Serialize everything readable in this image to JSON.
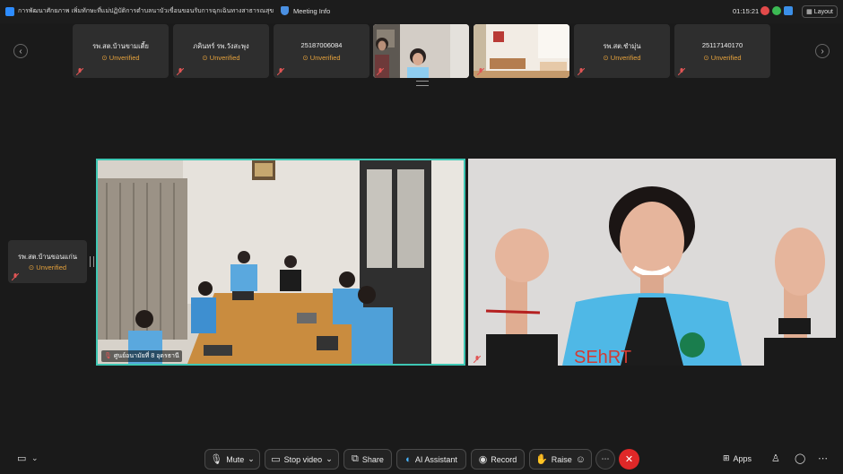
{
  "window": {
    "title": "การพัฒนาศักยภาพ เพิ่มทักษะที่แม่ปฏิบัติการตำบลนาบัวเขื่อนขอนรับการฉุกเฉินทางสาธารณสุข",
    "meeting_info": "Meeting Info",
    "time": "01:15:21",
    "layout_label": "Layout"
  },
  "participants": [
    {
      "name": "รพ.สต.บ้านขามเตี้ย",
      "status": "Unverified",
      "video": false
    },
    {
      "name": "ภคินทร์ รพ.วังสะพุง",
      "status": "Unverified",
      "video": false
    },
    {
      "name": "25187006084",
      "status": "Unverified",
      "video": false
    },
    {
      "name": "",
      "status": "",
      "video": true
    },
    {
      "name": "",
      "status": "",
      "video": true
    },
    {
      "name": "รพ.สต.ชำมุ่น",
      "status": "Unverified",
      "video": false
    },
    {
      "name": "25117140170",
      "status": "Unverified",
      "video": false
    }
  ],
  "side_tile": {
    "name": "รพ.สต.บ้านขอนแก่น",
    "status": "Unverified"
  },
  "main_video_left": {
    "label": "ศูนย์อนามัยที่ 8 อุดรธานี"
  },
  "main_video_right": {
    "vest_text": "SEhRT"
  },
  "toolbar": {
    "mute": "Mute",
    "stop_video": "Stop video",
    "share": "Share",
    "ai_assistant": "AI Assistant",
    "record": "Record",
    "raise": "Raise",
    "apps": "Apps"
  },
  "colors": {
    "accent_border": "#3ec7b4",
    "unverified": "#e6a23c",
    "end_call": "#e02828"
  }
}
